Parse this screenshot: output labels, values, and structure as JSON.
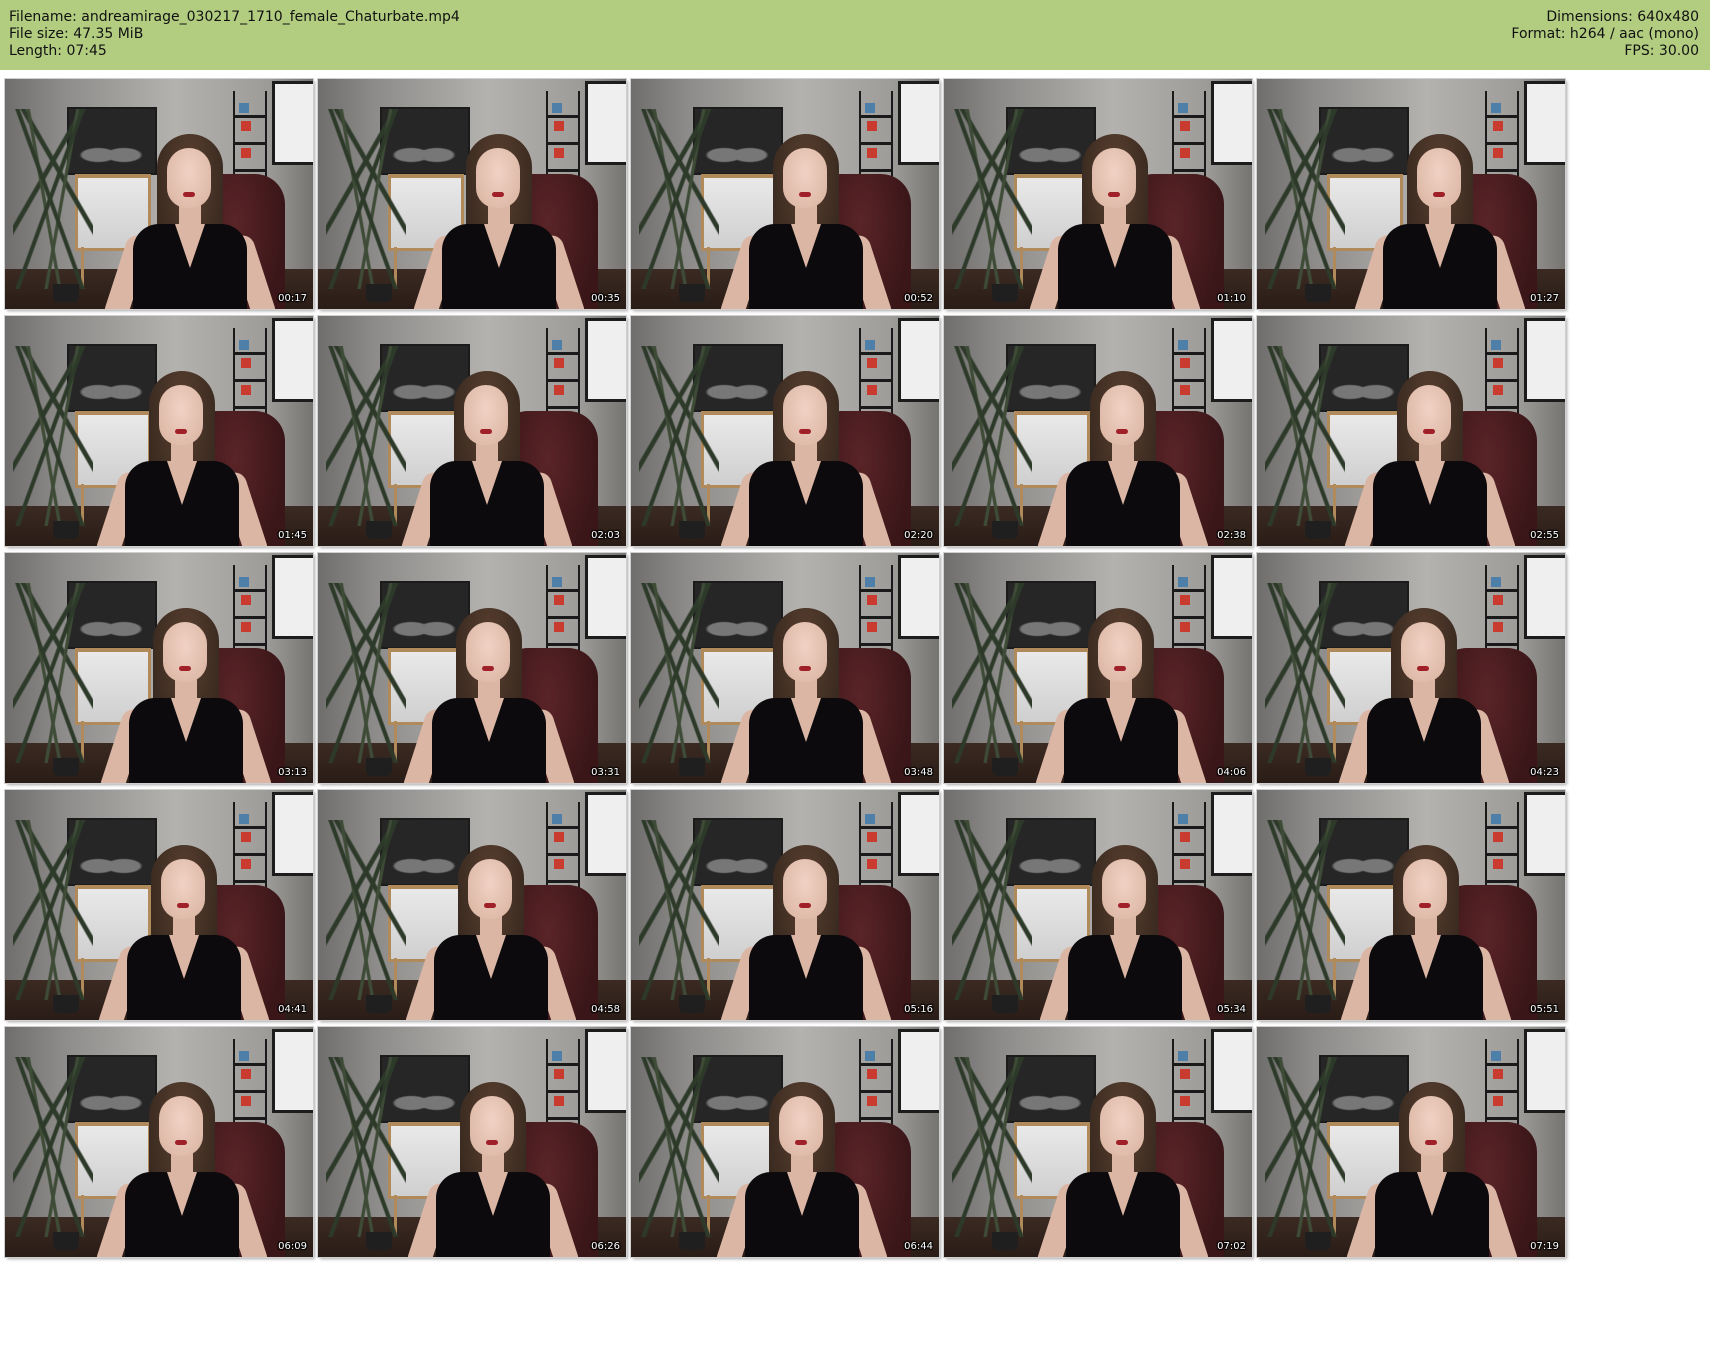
{
  "header": {
    "filename_line": "Filename: andreamirage_030217_1710_female_Chaturbate.mp4",
    "filesize_line": "File size: 47.35 MiB",
    "length_line": "Length: 07:45",
    "dimensions_line": "Dimensions: 640x480",
    "format_line": "Format: h264 / aac (mono)",
    "fps_line": "FPS: 30.00",
    "background_color": "#b2cd80"
  },
  "thumbnails": [
    {
      "time": "00:17"
    },
    {
      "time": "00:35"
    },
    {
      "time": "00:52"
    },
    {
      "time": "01:10"
    },
    {
      "time": "01:27"
    },
    {
      "time": "01:45"
    },
    {
      "time": "02:03"
    },
    {
      "time": "02:20"
    },
    {
      "time": "02:38"
    },
    {
      "time": "02:55"
    },
    {
      "time": "03:13"
    },
    {
      "time": "03:31"
    },
    {
      "time": "03:48"
    },
    {
      "time": "04:06"
    },
    {
      "time": "04:23"
    },
    {
      "time": "04:41"
    },
    {
      "time": "04:58"
    },
    {
      "time": "05:16"
    },
    {
      "time": "05:34"
    },
    {
      "time": "05:51"
    },
    {
      "time": "06:09"
    },
    {
      "time": "06:26"
    },
    {
      "time": "06:44"
    },
    {
      "time": "07:02"
    },
    {
      "time": "07:19"
    }
  ]
}
